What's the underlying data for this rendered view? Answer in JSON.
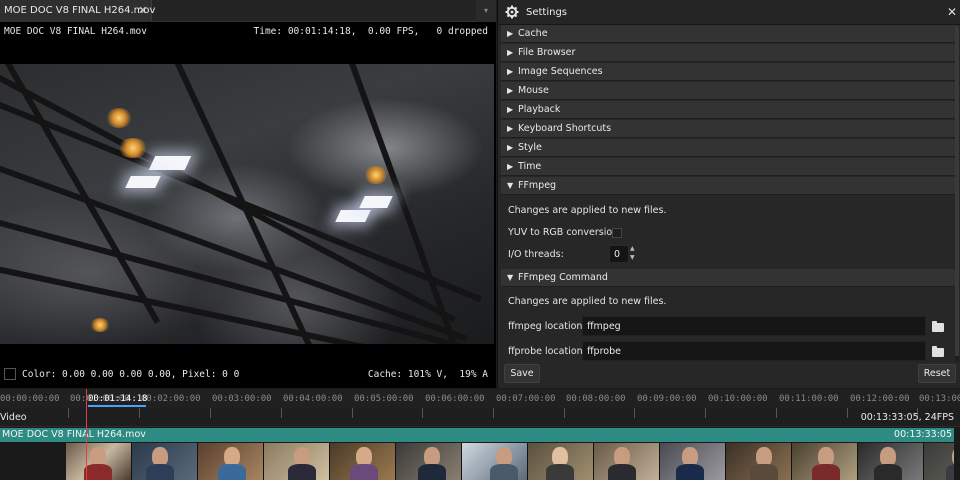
{
  "viewer": {
    "tab_label": "MOE DOC V8 FINAL H264.mov",
    "tab_close": "✕",
    "tab_menu": "▾",
    "hud_file": "MOE DOC V8 FINAL H264.mov",
    "hud_time": "Time: 00:01:14:18,  0.00 FPS,   0 dropped",
    "hud_color": "Color: 0.00 0.00 0.00 0.00, Pixel: 0 0",
    "hud_cache": "Cache: 101% V,  19% A"
  },
  "settings": {
    "title": "Settings",
    "close": "✕",
    "sections": [
      {
        "label": "Cache",
        "arrow": "▶"
      },
      {
        "label": "File Browser",
        "arrow": "▶"
      },
      {
        "label": "Image Sequences",
        "arrow": "▶"
      },
      {
        "label": "Mouse",
        "arrow": "▶"
      },
      {
        "label": "Playback",
        "arrow": "▶"
      },
      {
        "label": "Keyboard Shortcuts",
        "arrow": "▶"
      },
      {
        "label": "Style",
        "arrow": "▶"
      },
      {
        "label": "Time",
        "arrow": "▶"
      },
      {
        "label": "FFmpeg",
        "arrow": "▼"
      },
      {
        "label": "FFmpeg Command",
        "arrow": "▼"
      }
    ],
    "ffmpeg": {
      "note": "Changes are applied to new files.",
      "yuv_label": "YUV to RGB conversion:",
      "yuv_checked": false,
      "threads_label": "I/O threads:",
      "threads_value": "0",
      "spin_up": "▲",
      "spin_down": "▼"
    },
    "ffmpeg_command": {
      "note": "Changes are applied to new files.",
      "ffmpeg_label": "ffmpeg location:",
      "ffmpeg_value": "ffmpeg",
      "ffprobe_label": "ffprobe location:",
      "ffprobe_value": "ffprobe"
    },
    "save_label": "Save",
    "reset_label": "Reset"
  },
  "timeline": {
    "ticks": [
      "00:00:00:00",
      "00:01:00:00",
      "00:02:00:00",
      "00:03:00:00",
      "00:04:00:00",
      "00:05:00:00",
      "00:06:00:00",
      "00:07:00:00",
      "00:08:00:00",
      "00:09:00:00",
      "00:10:00:00",
      "00:11:00:00",
      "00:12:00:00",
      "00:13:00"
    ],
    "current_time": "00:01:14:18",
    "track_label": "Video",
    "track_duration": "00:13:33:05, 24FPS",
    "clip_name": "MOE DOC V8 FINAL H264.mov",
    "clip_duration": "00:13:33:05",
    "playhead_fraction": 0.0917,
    "clip_color": "#2e8b84"
  }
}
